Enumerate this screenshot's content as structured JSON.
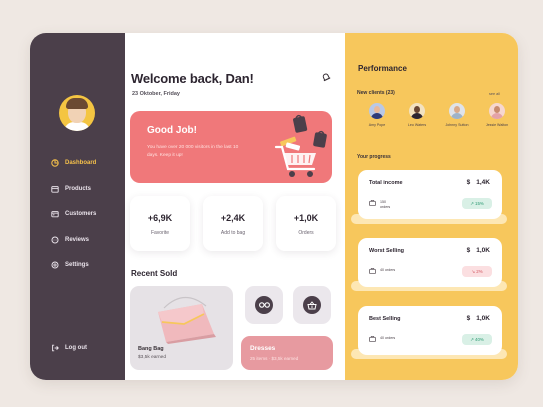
{
  "sidebar": {
    "items": [
      {
        "label": "Dashboard",
        "icon": "pie-chart-icon",
        "active": true
      },
      {
        "label": "Products",
        "icon": "box-icon",
        "active": false
      },
      {
        "label": "Customers",
        "icon": "customers-icon",
        "active": false
      },
      {
        "label": "Reviews",
        "icon": "chat-icon",
        "active": false
      },
      {
        "label": "Settings",
        "icon": "gear-icon",
        "active": false
      }
    ],
    "logout_label": "Log out"
  },
  "header": {
    "welcome": "Welcome back, Dan!",
    "date": "23 Oktober, Friday"
  },
  "hero": {
    "title": "Good Job!",
    "text": "You have over 20 000 visitors in the last 10 days. Keep it up!"
  },
  "stats": [
    {
      "value": "+6,9K",
      "label": "Favorite"
    },
    {
      "value": "+2,4K",
      "label": "Add to bag"
    },
    {
      "value": "+1,0K",
      "label": "Orders"
    }
  ],
  "recent": {
    "title": "Recent Sold",
    "product": {
      "name": "Bang Bag",
      "earned": "$3,5k earned"
    },
    "dress": {
      "title": "Dresses",
      "meta": "25 items · $3,5k earned"
    }
  },
  "performance": {
    "title": "Performance",
    "clients_label": "New clients (23)",
    "see_all": "see all",
    "clients": [
      {
        "name": "Amy Pope",
        "skin": "#e9b99a",
        "shirt": "#2f3b78"
      },
      {
        "name": "Leo Waters",
        "skin": "#6a4632",
        "shirt": "#2d2530"
      },
      {
        "name": "Johnny Sutton",
        "skin": "#d9a98a",
        "shirt": "#9fb3c8"
      },
      {
        "name": "Jessie Walton",
        "skin": "#c98b6e",
        "shirt": "#e4a3a8"
      }
    ],
    "progress_label": "Your progress",
    "metrics": [
      {
        "title": "Total income",
        "currency": "$",
        "value": "1,4K",
        "orders": "150 orders",
        "badge": "15%",
        "trend": "up"
      },
      {
        "title": "Worst Selling",
        "currency": "$",
        "value": "1,0K",
        "orders": "40 orders",
        "badge": "2%",
        "trend": "down"
      },
      {
        "title": "Best Selling",
        "currency": "$",
        "value": "1,0K",
        "orders": "40 orders",
        "badge": "40%",
        "trend": "up"
      }
    ]
  },
  "colors": {
    "sidebar": "#4b3f4a",
    "accent_yellow": "#f7c75c",
    "hero_coral": "#f0787a",
    "dress_pink": "#e79aa0"
  }
}
